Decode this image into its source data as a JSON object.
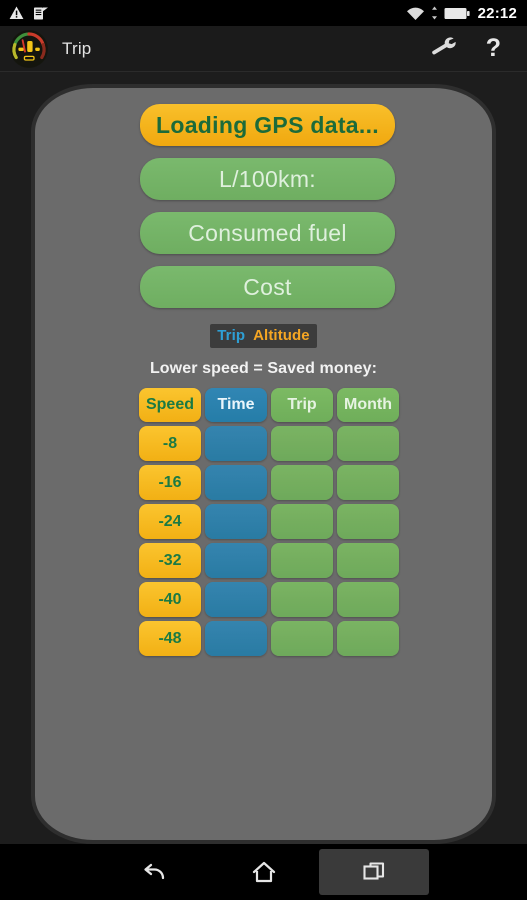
{
  "status_bar": {
    "icons": [
      "warning-triangle-icon",
      "clipboard-icon"
    ],
    "right_icons": [
      "wifi-icon",
      "data-transfer-icon",
      "battery-icon"
    ],
    "clock": "22:12"
  },
  "action_bar": {
    "app_icon": "speedometer-gauge-icon",
    "title": "Trip",
    "settings_icon": "wrench-icon",
    "help_label": "?"
  },
  "info_buttons": [
    {
      "label": "Loading GPS data...",
      "style": "orange"
    },
    {
      "label": "L/100km:",
      "style": "green"
    },
    {
      "label": "Consumed fuel",
      "style": "green"
    },
    {
      "label": "Cost",
      "style": "green"
    }
  ],
  "mode_toggle": {
    "trip_label": "Trip",
    "altitude_label": "Altitude",
    "trip_color": "#2e9fd4",
    "altitude_color": "#f5a623"
  },
  "caption": "Lower speed = Saved money:",
  "savings_table": {
    "headers": [
      "Speed",
      "Time",
      "Trip",
      "Month"
    ],
    "rows": [
      {
        "speed": "-8",
        "time": "",
        "trip": "",
        "month": ""
      },
      {
        "speed": "-16",
        "time": "",
        "trip": "",
        "month": ""
      },
      {
        "speed": "-24",
        "time": "",
        "trip": "",
        "month": ""
      },
      {
        "speed": "-32",
        "time": "",
        "trip": "",
        "month": ""
      },
      {
        "speed": "-40",
        "time": "",
        "trip": "",
        "month": ""
      },
      {
        "speed": "-48",
        "time": "",
        "trip": "",
        "month": ""
      }
    ]
  },
  "nav_bar": {
    "back": "back-icon",
    "home": "home-icon",
    "recents": "recents-icon"
  },
  "colors": {
    "orange": "#f5b716",
    "green": "#76b564",
    "blue": "#2c7fab",
    "panel": "#6b6b6b",
    "speed_text": "#1b7a44"
  }
}
